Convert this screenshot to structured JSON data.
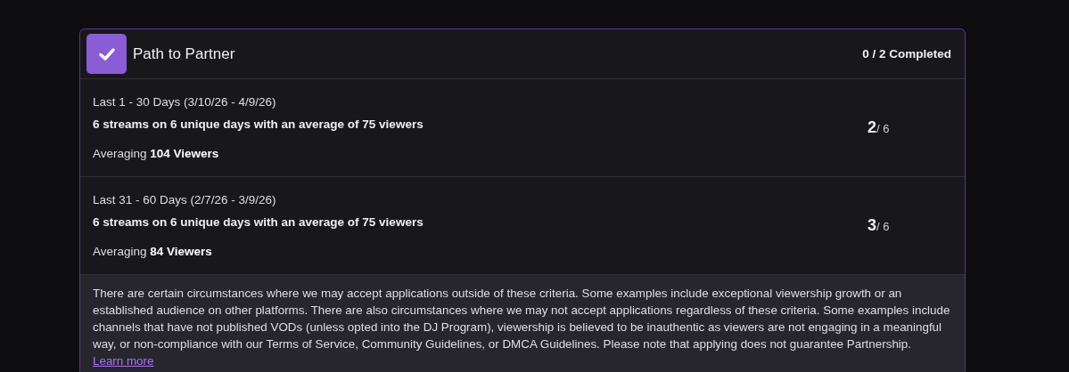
{
  "header": {
    "title": "Path to Partner",
    "completed": "0 / 2 Completed"
  },
  "periods": [
    {
      "range": "Last 1 - 30 Days (3/10/26 - 4/9/26)",
      "requirement": "6 streams on 6 unique days with an average of 75 viewers",
      "averaging": "Averaging **104 Viewers**",
      "current": "2",
      "total": "/ 6"
    },
    {
      "range": "Last 31 - 60 Days (2/7/26 - 3/9/26)",
      "requirement": "6 streams on 6 unique days with an average of 75 viewers",
      "averaging": "Averaging **84 Viewers**",
      "current": "3",
      "total": "/ 6"
    }
  ],
  "footer": {
    "text": "There are certain circumstances where we may accept applications outside of these criteria. Some examples include exceptional viewership growth or an established audience on other platforms. There are also circumstances where we may not accept applications regardless of these criteria. Some examples include channels that have not published VODs (unless opted into the DJ Program), viewership is believed to be inauthentic as viewers are not engaging in a meaningful way, or non-compliance with our Terms of Service, Community Guidelines, or DMCA Guidelines. Please note that applying does not guarantee Partnership.",
    "link": "Learn more"
  }
}
